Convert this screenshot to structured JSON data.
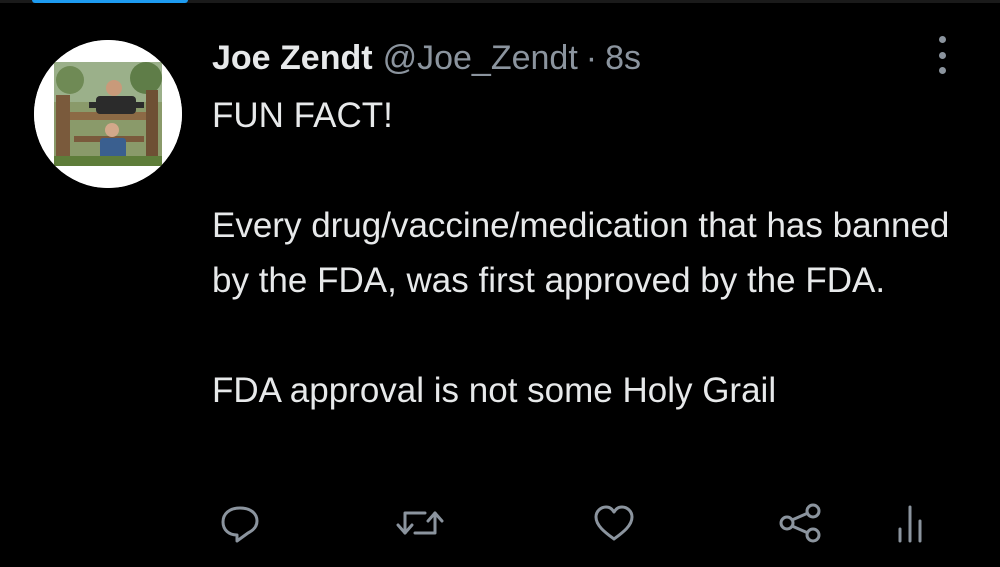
{
  "tweet": {
    "display_name": "Joe Zendt",
    "handle": "@Joe_Zendt",
    "separator": "·",
    "time": "8s",
    "paragraphs": [
      "FUN FACT!",
      "Every drug/vaccine/medication that has banned by the FDA, was first approved by the FDA.",
      "FDA approval is not some Holy Grail"
    ]
  },
  "actions": {
    "icons": [
      "reply-icon",
      "retweet-icon",
      "like-icon",
      "share-icon",
      "analytics-icon"
    ]
  },
  "colors": {
    "background": "#000000",
    "text_primary": "#e7e9ea",
    "text_secondary": "#8b949e",
    "accent": "#1d9bf0"
  }
}
